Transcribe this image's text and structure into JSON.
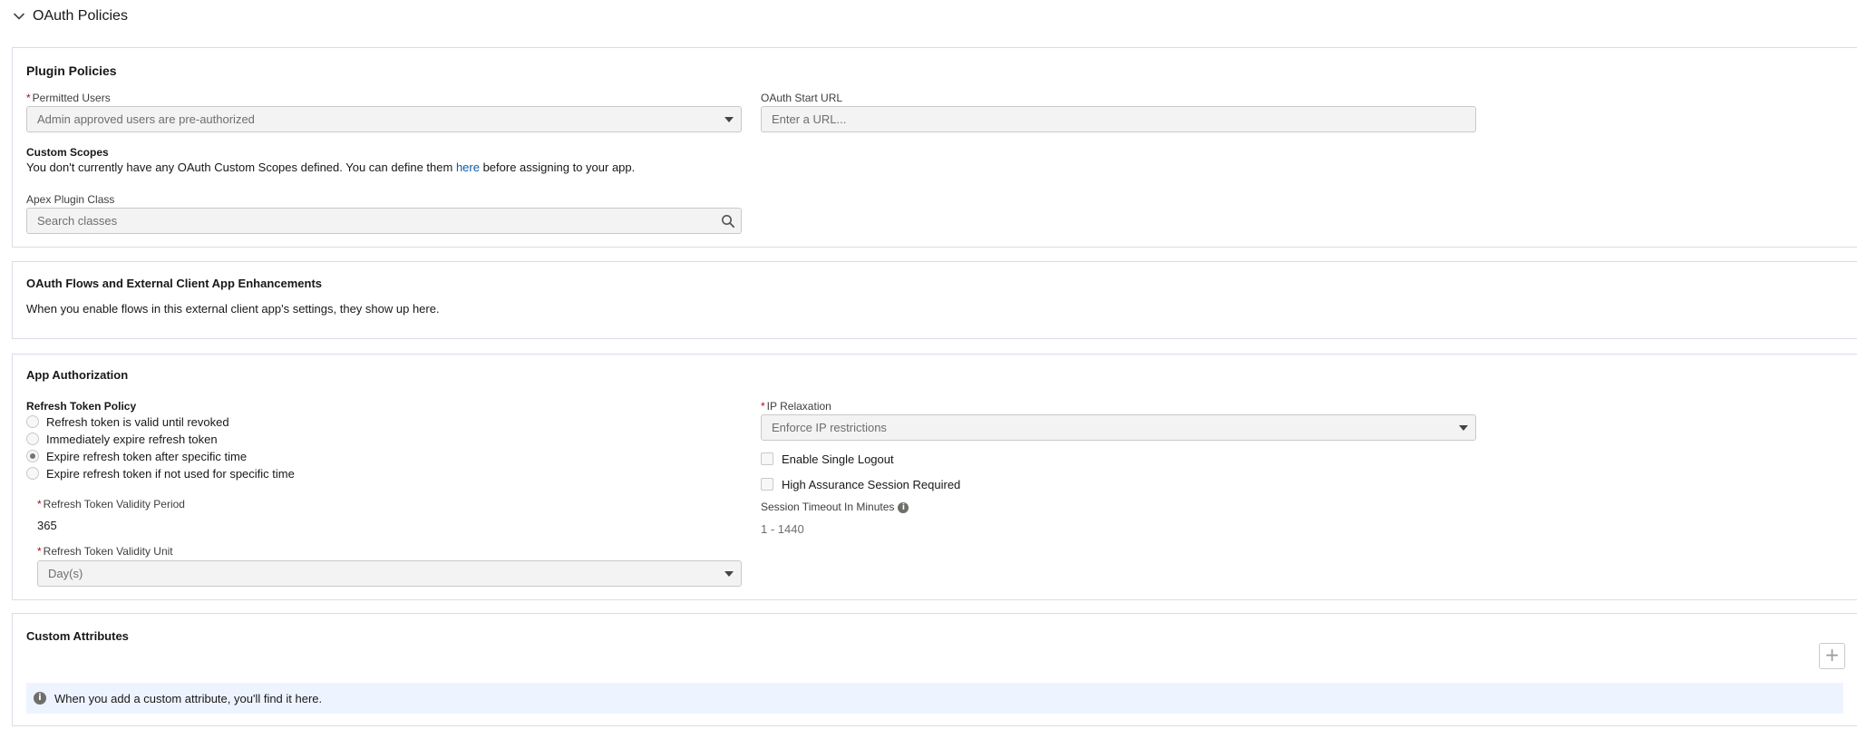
{
  "header": {
    "title": "OAuth Policies"
  },
  "plugin_policies": {
    "title": "Plugin Policies",
    "permitted_users": {
      "label": "Permitted Users",
      "value": "Admin approved users are pre-authorized"
    },
    "oauth_start_url": {
      "label": "OAuth Start URL",
      "placeholder": "Enter a URL..."
    },
    "custom_scopes": {
      "label": "Custom Scopes",
      "text_before": "You don't currently have any OAuth Custom Scopes defined. You can define them ",
      "link": "here",
      "text_after": " before assigning to your app."
    },
    "apex_plugin_class": {
      "label": "Apex Plugin Class",
      "placeholder": "Search classes"
    }
  },
  "flows": {
    "title": "OAuth Flows and External Client App Enhancements",
    "message": "When you enable flows in this external client app's settings, they show up here."
  },
  "app_authorization": {
    "title": "App Authorization",
    "refresh_token_policy": {
      "label": "Refresh Token Policy",
      "options": [
        {
          "label": "Refresh token is valid until revoked",
          "checked": false
        },
        {
          "label": "Immediately expire refresh token",
          "checked": false
        },
        {
          "label": "Expire refresh token after specific time",
          "checked": true
        },
        {
          "label": "Expire refresh token if not used for specific time",
          "checked": false
        }
      ]
    },
    "validity_period": {
      "label": "Refresh Token Validity Period",
      "value": "365"
    },
    "validity_unit": {
      "label": "Refresh Token Validity Unit",
      "value": "Day(s)"
    },
    "ip_relaxation": {
      "label": "IP Relaxation",
      "value": "Enforce IP restrictions"
    },
    "single_logout": {
      "label": "Enable Single Logout",
      "checked": false
    },
    "high_assurance": {
      "label": "High Assurance Session Required",
      "checked": false
    },
    "session_timeout": {
      "label": "Session Timeout In Minutes",
      "placeholder": "1 - 1440"
    }
  },
  "custom_attributes": {
    "title": "Custom Attributes",
    "add_label": "+",
    "empty_message": "When you add a custom attribute, you'll find it here."
  },
  "icons": {
    "collapse": "chevron-down-icon",
    "search": "search-icon",
    "info": "info-icon"
  }
}
